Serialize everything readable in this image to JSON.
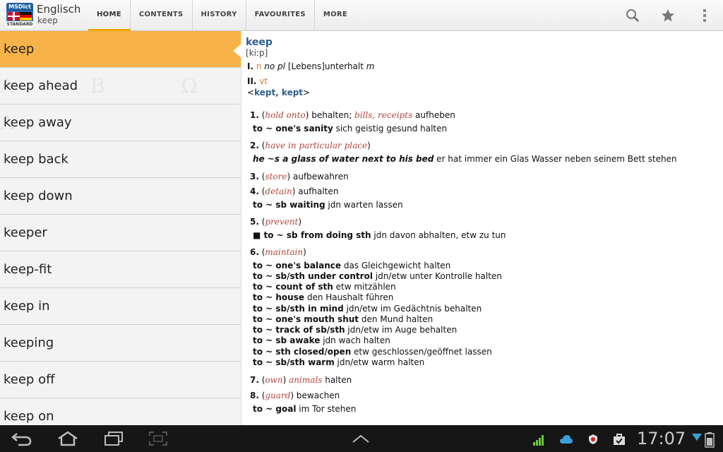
{
  "app": {
    "title": "Englisch",
    "subtitle": "keep",
    "logo_top": "MSDict",
    "logo_bottom": "STANDARD"
  },
  "tabs": [
    {
      "label": "HOME",
      "active": true
    },
    {
      "label": "CONTENTS"
    },
    {
      "label": "HISTORY"
    },
    {
      "label": "FAVOURITES"
    },
    {
      "label": "MORE"
    }
  ],
  "icons": {
    "search": "search-icon",
    "star": "star-icon",
    "menu": "overflow-menu-icon"
  },
  "word_list": [
    "keep",
    "keep ahead",
    "keep away",
    "keep back",
    "keep down",
    "keeper",
    "keep-fit",
    "keep in",
    "keeping",
    "keep off",
    "keep on"
  ],
  "entry": {
    "headword": "keep",
    "ipa": "[kiːp]",
    "sec1": {
      "roman": "I.",
      "pos": "n",
      "gram": "no pl",
      "text": "[Lebens]unterhalt",
      "gender": "m"
    },
    "sec2": {
      "roman": "II.",
      "pos": "vt",
      "forms": "kept, kept"
    },
    "senses": [
      {
        "n": "1.",
        "note": "hold onto",
        "text": " behalten; ",
        "note2": "bills, receipts",
        "text2": " aufheben",
        "ex": [
          {
            "en": "to ~ one's sanity",
            "de": " sich geistig gesund halten"
          }
        ]
      },
      {
        "n": "2.",
        "note": "have in particular place",
        "ex": [
          {
            "en": "he ~s a glass of water next to his bed",
            "de": " er hat immer ein Glas Wasser neben seinem Bett stehen"
          }
        ]
      },
      {
        "n": "3.",
        "note": "store",
        "text": " aufbewahren"
      },
      {
        "n": "4.",
        "note": "detain",
        "text": " aufhalten",
        "ex": [
          {
            "en": "to ~ sb waiting",
            "de": " jdn warten lassen"
          }
        ]
      },
      {
        "n": "5.",
        "note": "prevent",
        "ex": [
          {
            "en": "■ to ~ sb from doing sth",
            "de": " jdn davon abhalten, etw zu tun"
          }
        ]
      },
      {
        "n": "6.",
        "note": "maintain",
        "ex": [
          {
            "en": "to ~ one's balance",
            "de": " das Gleichgewicht halten"
          },
          {
            "en": "to ~ sb/sth under control",
            "de": " jdn/etw unter Kontrolle halten"
          },
          {
            "en": "to ~ count of sth",
            "de": " etw mitzählen"
          },
          {
            "en": "to ~ house",
            "de": " den Haushalt führen"
          },
          {
            "en": "to ~ sb/sth in mind",
            "de": " jdn/etw im Gedächtnis behalten"
          },
          {
            "en": "to ~ one's mouth shut",
            "de": " den Mund halten"
          },
          {
            "en": "to ~ track of sb/sth",
            "de": " jdn/etw im Auge behalten"
          },
          {
            "en": "to ~ sb awake",
            "de": " jdn wach halten"
          },
          {
            "en": "to ~ sth closed/open",
            "de": " etw geschlossen/geöffnet lassen"
          },
          {
            "en": "to ~ sb/sth warm",
            "de": " jdn/etw warm halten"
          }
        ]
      },
      {
        "n": "7.",
        "note": "own",
        "note2": "animals",
        "text2": " halten"
      },
      {
        "n": "8.",
        "note": "guard",
        "text": " bewachen",
        "ex": [
          {
            "en": "to ~ goal",
            "de": " im Tor stehen"
          }
        ]
      }
    ]
  },
  "status": {
    "time": "17:07"
  }
}
